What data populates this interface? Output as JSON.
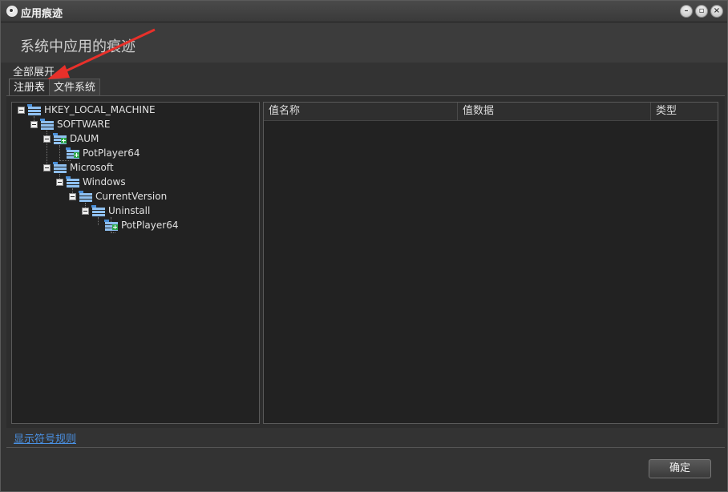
{
  "window": {
    "title": "应用痕迹"
  },
  "header": {
    "title": "系统中应用的痕迹"
  },
  "toolbar": {
    "expand_all_label": "全部展开"
  },
  "tabs": [
    {
      "label": "注册表",
      "active": true
    },
    {
      "label": "文件系统",
      "active": false
    }
  ],
  "tree": {
    "nodes": [
      {
        "label": "HKEY_LOCAL_MACHINE",
        "level": 0,
        "expanded": true,
        "icon": "registry-key-icon"
      },
      {
        "label": "SOFTWARE",
        "level": 1,
        "expanded": true,
        "icon": "registry-key-icon"
      },
      {
        "label": "DAUM",
        "level": 2,
        "expanded": true,
        "icon": "registry-key-added-icon"
      },
      {
        "label": "PotPlayer64",
        "level": 3,
        "expanded": false,
        "icon": "registry-key-added-icon"
      },
      {
        "label": "Microsoft",
        "level": 2,
        "expanded": true,
        "icon": "registry-key-icon"
      },
      {
        "label": "Windows",
        "level": 3,
        "expanded": true,
        "icon": "registry-key-icon"
      },
      {
        "label": "CurrentVersion",
        "level": 4,
        "expanded": true,
        "icon": "registry-key-icon"
      },
      {
        "label": "Uninstall",
        "level": 5,
        "expanded": true,
        "icon": "registry-key-icon"
      },
      {
        "label": "PotPlayer64",
        "level": 6,
        "expanded": false,
        "icon": "registry-key-added-icon"
      }
    ]
  },
  "value_list": {
    "columns": [
      "值名称",
      "值数据",
      "类型"
    ],
    "rows": []
  },
  "footer": {
    "legend_link": "显示符号规则",
    "ok_label": "确定"
  },
  "colors": {
    "annotation_arrow": "#e8302a",
    "link": "#4a90e2",
    "icon_blue": "#4a8fd8",
    "icon_green": "#2fa84f"
  }
}
